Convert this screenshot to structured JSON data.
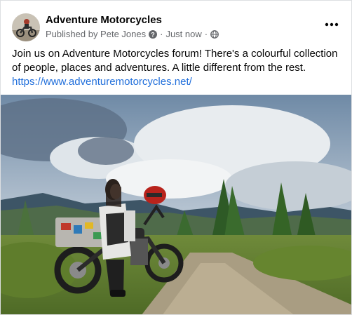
{
  "post": {
    "page_name": "Adventure Motorcycles",
    "published_by": "Published by Pete Jones",
    "time": "Just now",
    "separator": "·",
    "text": "Join us on Adventure Motorcycles forum! There's a colourful collection of people, places and adventures. A little different from the rest.",
    "link": "https://www.adventuremotorcycles.net/"
  },
  "icons": {
    "help": "question-circle-icon",
    "audience": "globe-icon",
    "more": "more-horizontal-icon"
  },
  "colors": {
    "name": "#050505",
    "meta": "#65676b",
    "link": "#216fdb",
    "sky": "#8fa6bd",
    "forest": "#3f6b2b"
  }
}
